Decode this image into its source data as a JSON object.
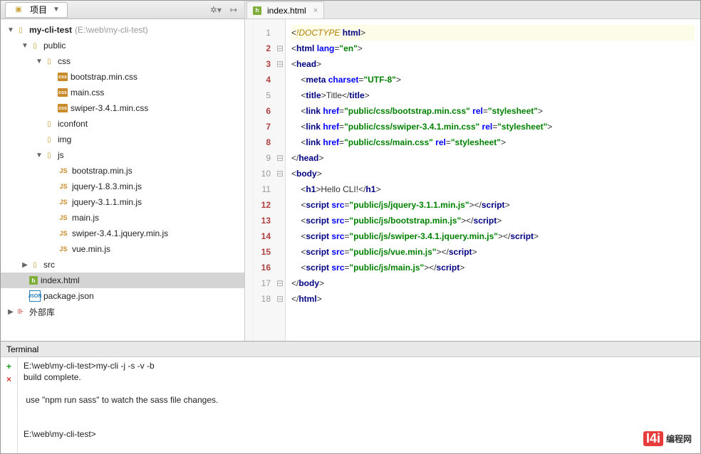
{
  "sidebar": {
    "tab_label": "项目",
    "tree": [
      {
        "depth": 0,
        "arrow": "▼",
        "iconType": "folder",
        "label": "my-cli-test",
        "hint": "(E:\\web\\my-cli-test)",
        "bold": true
      },
      {
        "depth": 1,
        "arrow": "▼",
        "iconType": "folder",
        "label": "public"
      },
      {
        "depth": 2,
        "arrow": "▼",
        "iconType": "folder",
        "label": "css"
      },
      {
        "depth": 3,
        "arrow": "",
        "iconType": "css",
        "label": "bootstrap.min.css"
      },
      {
        "depth": 3,
        "arrow": "",
        "iconType": "css",
        "label": "main.css"
      },
      {
        "depth": 3,
        "arrow": "",
        "iconType": "css",
        "label": "swiper-3.4.1.min.css"
      },
      {
        "depth": 2,
        "arrow": "",
        "iconType": "folder",
        "label": "iconfont"
      },
      {
        "depth": 2,
        "arrow": "",
        "iconType": "folder",
        "label": "img"
      },
      {
        "depth": 2,
        "arrow": "▼",
        "iconType": "folder",
        "label": "js"
      },
      {
        "depth": 3,
        "arrow": "",
        "iconType": "js",
        "label": "bootstrap.min.js"
      },
      {
        "depth": 3,
        "arrow": "",
        "iconType": "js",
        "label": "jquery-1.8.3.min.js"
      },
      {
        "depth": 3,
        "arrow": "",
        "iconType": "js",
        "label": "jquery-3.1.1.min.js"
      },
      {
        "depth": 3,
        "arrow": "",
        "iconType": "js",
        "label": "main.js"
      },
      {
        "depth": 3,
        "arrow": "",
        "iconType": "js",
        "label": "swiper-3.4.1.jquery.min.js"
      },
      {
        "depth": 3,
        "arrow": "",
        "iconType": "js",
        "label": "vue.min.js"
      },
      {
        "depth": 1,
        "arrow": "▶",
        "iconType": "folder",
        "label": "src"
      },
      {
        "depth": 1,
        "arrow": "",
        "iconType": "html",
        "label": "index.html",
        "selected": true
      },
      {
        "depth": 1,
        "arrow": "",
        "iconType": "json",
        "label": "package.json"
      },
      {
        "depth": 0,
        "arrow": "▶",
        "iconType": "lib",
        "label": "外部库"
      }
    ]
  },
  "editor": {
    "tab_label": "index.html",
    "lines": [
      {
        "n": 1,
        "fold": "",
        "hl": true,
        "tokens": [
          [
            "ang",
            "<"
          ],
          [
            "bang",
            "!DOCTYPE "
          ],
          [
            "tag",
            "html"
          ],
          [
            "ang",
            ">"
          ]
        ]
      },
      {
        "n": 2,
        "fold": "⊟",
        "changed": true,
        "tokens": [
          [
            "ang",
            "<"
          ],
          [
            "tag",
            "html "
          ],
          [
            "attr",
            "lang"
          ],
          [
            "ang",
            "="
          ],
          [
            "str",
            "\"en\""
          ],
          [
            "ang",
            ">"
          ]
        ]
      },
      {
        "n": 3,
        "fold": "⊟",
        "changed": true,
        "tokens": [
          [
            "ang",
            "<"
          ],
          [
            "tag",
            "head"
          ],
          [
            "ang",
            ">"
          ]
        ]
      },
      {
        "n": 4,
        "fold": "",
        "changed": true,
        "indent": 1,
        "tokens": [
          [
            "ang",
            "<"
          ],
          [
            "tag",
            "meta "
          ],
          [
            "attr",
            "charset"
          ],
          [
            "ang",
            "="
          ],
          [
            "str",
            "\"UTF-8\""
          ],
          [
            "ang",
            ">"
          ]
        ]
      },
      {
        "n": 5,
        "fold": "",
        "indent": 1,
        "tokens": [
          [
            "ang",
            "<"
          ],
          [
            "tag",
            "title"
          ],
          [
            "ang",
            ">"
          ],
          [
            "text",
            "Title"
          ],
          [
            "ang",
            "</"
          ],
          [
            "tag",
            "title"
          ],
          [
            "ang",
            ">"
          ]
        ]
      },
      {
        "n": 6,
        "fold": "",
        "changed": true,
        "indent": 1,
        "tokens": [
          [
            "ang",
            "<"
          ],
          [
            "tag",
            "link "
          ],
          [
            "attr",
            "href"
          ],
          [
            "ang",
            "="
          ],
          [
            "str",
            "\"public/css/bootstrap.min.css\""
          ],
          [
            "attr",
            " rel"
          ],
          [
            "ang",
            "="
          ],
          [
            "str",
            "\"stylesheet\""
          ],
          [
            "ang",
            ">"
          ]
        ]
      },
      {
        "n": 7,
        "fold": "",
        "changed": true,
        "indent": 1,
        "tokens": [
          [
            "ang",
            "<"
          ],
          [
            "tag",
            "link "
          ],
          [
            "attr",
            "href"
          ],
          [
            "ang",
            "="
          ],
          [
            "str",
            "\"public/css/swiper-3.4.1.min.css\""
          ],
          [
            "attr",
            " rel"
          ],
          [
            "ang",
            "="
          ],
          [
            "str",
            "\"stylesheet\""
          ],
          [
            "ang",
            ">"
          ]
        ]
      },
      {
        "n": 8,
        "fold": "",
        "changed": true,
        "indent": 1,
        "tokens": [
          [
            "ang",
            "<"
          ],
          [
            "tag",
            "link "
          ],
          [
            "attr",
            "href"
          ],
          [
            "ang",
            "="
          ],
          [
            "str",
            "\"public/css/main.css\""
          ],
          [
            "attr",
            " rel"
          ],
          [
            "ang",
            "="
          ],
          [
            "str",
            "\"stylesheet\""
          ],
          [
            "ang",
            ">"
          ]
        ]
      },
      {
        "n": 9,
        "fold": "⊟",
        "tokens": [
          [
            "ang",
            "</"
          ],
          [
            "tag",
            "head"
          ],
          [
            "ang",
            ">"
          ]
        ]
      },
      {
        "n": 10,
        "fold": "⊟",
        "tokens": [
          [
            "ang",
            "<"
          ],
          [
            "tag",
            "body"
          ],
          [
            "ang",
            ">"
          ]
        ]
      },
      {
        "n": 11,
        "fold": "",
        "indent": 1,
        "tokens": [
          [
            "ang",
            "<"
          ],
          [
            "tag",
            "h1"
          ],
          [
            "ang",
            ">"
          ],
          [
            "text",
            "Hello CLI!"
          ],
          [
            "ang",
            "</"
          ],
          [
            "tag",
            "h1"
          ],
          [
            "ang",
            ">"
          ]
        ]
      },
      {
        "n": 12,
        "fold": "",
        "changed": true,
        "indent": 1,
        "tokens": [
          [
            "ang",
            "<"
          ],
          [
            "tag",
            "script "
          ],
          [
            "attr",
            "src"
          ],
          [
            "ang",
            "="
          ],
          [
            "str",
            "\"public/js/jquery-3.1.1.min.js\""
          ],
          [
            "ang",
            "></"
          ],
          [
            "tag",
            "script"
          ],
          [
            "ang",
            ">"
          ]
        ]
      },
      {
        "n": 13,
        "fold": "",
        "changed": true,
        "indent": 1,
        "tokens": [
          [
            "ang",
            "<"
          ],
          [
            "tag",
            "script "
          ],
          [
            "attr",
            "src"
          ],
          [
            "ang",
            "="
          ],
          [
            "str",
            "\"public/js/bootstrap.min.js\""
          ],
          [
            "ang",
            "></"
          ],
          [
            "tag",
            "script"
          ],
          [
            "ang",
            ">"
          ]
        ]
      },
      {
        "n": 14,
        "fold": "",
        "changed": true,
        "indent": 1,
        "tokens": [
          [
            "ang",
            "<"
          ],
          [
            "tag",
            "script "
          ],
          [
            "attr",
            "src"
          ],
          [
            "ang",
            "="
          ],
          [
            "str",
            "\"public/js/swiper-3.4.1.jquery.min.js\""
          ],
          [
            "ang",
            "></"
          ],
          [
            "tag",
            "script"
          ],
          [
            "ang",
            ">"
          ]
        ]
      },
      {
        "n": 15,
        "fold": "",
        "changed": true,
        "indent": 1,
        "tokens": [
          [
            "ang",
            "<"
          ],
          [
            "tag",
            "script "
          ],
          [
            "attr",
            "src"
          ],
          [
            "ang",
            "="
          ],
          [
            "str",
            "\"public/js/vue.min.js\""
          ],
          [
            "ang",
            "></"
          ],
          [
            "tag",
            "script"
          ],
          [
            "ang",
            ">"
          ]
        ]
      },
      {
        "n": 16,
        "fold": "",
        "changed": true,
        "indent": 1,
        "tokens": [
          [
            "ang",
            "<"
          ],
          [
            "tag",
            "script "
          ],
          [
            "attr",
            "src"
          ],
          [
            "ang",
            "="
          ],
          [
            "str",
            "\"public/js/main.js\""
          ],
          [
            "ang",
            "></"
          ],
          [
            "tag",
            "script"
          ],
          [
            "ang",
            ">"
          ]
        ]
      },
      {
        "n": 17,
        "fold": "⊟",
        "tokens": [
          [
            "ang",
            "</"
          ],
          [
            "tag",
            "body"
          ],
          [
            "ang",
            ">"
          ]
        ]
      },
      {
        "n": 18,
        "fold": "⊟",
        "tokens": [
          [
            "ang",
            "</"
          ],
          [
            "tag",
            "html"
          ],
          [
            "ang",
            ">"
          ]
        ]
      }
    ]
  },
  "terminal": {
    "title": "Terminal",
    "lines": [
      "E:\\web\\my-cli-test>my-cli -j -s -v -b",
      "build complete.",
      "",
      " use \"npm run sass\" to watch the sass file changes.",
      "",
      "",
      "E:\\web\\my-cli-test>"
    ]
  },
  "watermark": "编程网"
}
